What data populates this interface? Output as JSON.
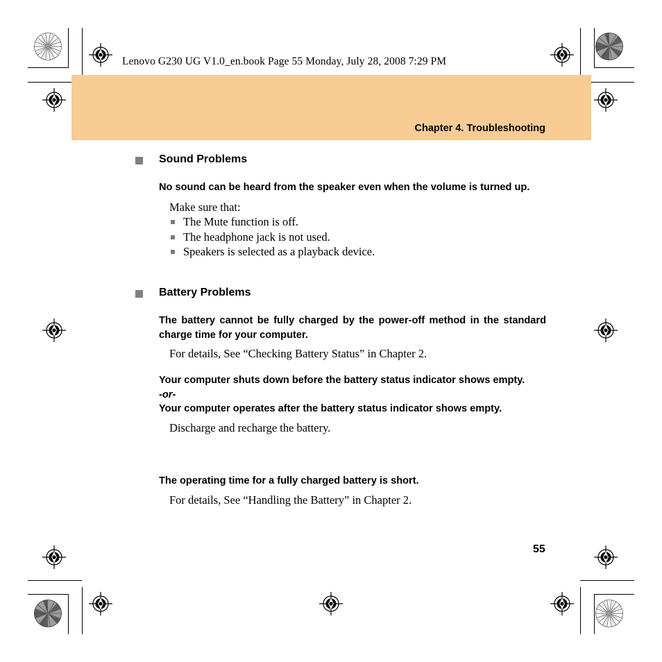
{
  "document": {
    "file_header": "Lenovo G230 UG V1.0_en.book  Page 55  Monday, July 28, 2008  7:29 PM",
    "chapter_title": "Chapter 4. Troubleshooting",
    "page_number": "55",
    "band_color": "#f9cb95",
    "bullet_color": "#808080"
  },
  "sections": [
    {
      "heading": "Sound Problems",
      "entries": [
        {
          "question": "No sound can be heard from the speaker even when the volume is turned up.",
          "answer_lead": "Make sure that:",
          "checks": [
            "The Mute function is off.",
            "The headphone jack is not used.",
            "Speakers is selected as a playback device."
          ]
        }
      ]
    },
    {
      "heading": "Battery Problems",
      "entries": [
        {
          "question": "The battery cannot be fully charged by the power-off method in the standard charge time for your computer.",
          "answer": "For details, See “Checking Battery Status” in Chapter 2."
        },
        {
          "question": "Your computer shuts down before the battery status indicator shows empty.",
          "separator": "-or-",
          "question2": "Your computer operates after the battery status indicator shows empty.",
          "answer": "Discharge and recharge the battery."
        },
        {
          "question": "The operating time for a fully charged battery is short.",
          "answer": "For details, See “Handling the Battery” in Chapter 2."
        }
      ]
    }
  ],
  "print_marks": {
    "registration_icon": "registration-target-icon",
    "rosette_icon": "color-rosette-icon"
  }
}
